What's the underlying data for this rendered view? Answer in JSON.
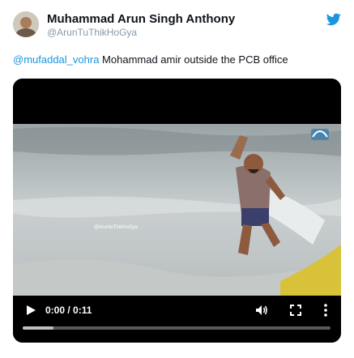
{
  "tweet": {
    "author": {
      "display_name": "Muhammad Arun Singh Anthony",
      "handle": "@ArunTuThikHoGya",
      "avatar_icon": "user-avatar-icon"
    },
    "platform_icon": "twitter-bird-icon",
    "accent_color": "#1b95e0",
    "text": {
      "mention": "@mufaddal_vohra",
      "body": " Mohammad amir outside the PCB office"
    }
  },
  "video": {
    "watermark": "@AruntuThikHoGya",
    "time_display": "0:00 / 0:11",
    "progress": 0.1,
    "controls": {
      "play_icon": "play-icon",
      "volume_icon": "volume-icon",
      "fullscreen_icon": "fullscreen-icon",
      "more_icon": "more-options-icon"
    }
  }
}
